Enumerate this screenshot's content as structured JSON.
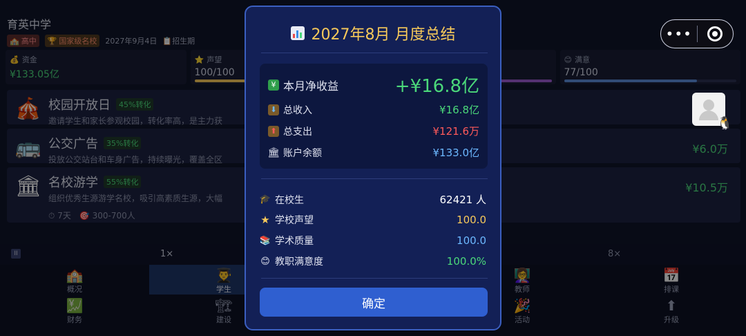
{
  "background": {
    "school_name": "育英中学",
    "tags": [
      "高中",
      "国家级名校",
      "2027年9月4日",
      "招生期"
    ],
    "stats": [
      {
        "label": "资金",
        "value": "¥133.05亿",
        "icon": "money-bag-icon"
      },
      {
        "label": "声望",
        "value": "100/100",
        "icon": "star-icon",
        "progress": 1.0
      },
      {
        "label": "",
        "value": "",
        "icon": ""
      },
      {
        "label": "满意",
        "value": "77/100",
        "icon": "smile-icon",
        "progress": 0.77
      }
    ],
    "activities": [
      {
        "title": "校园开放日",
        "conversion": "45%转化",
        "desc": "邀请学生和家长参观校园，转化率高，是主力获",
        "price": "",
        "icon": "circus-tent-icon"
      },
      {
        "title": "公交广告",
        "conversion": "35%转化",
        "desc": "投放公交站台和车身广告，持续曝光，覆盖全区",
        "price": "¥6.0万",
        "icon": "bus-icon"
      },
      {
        "title": "名校游学",
        "conversion": "55%转化",
        "desc": "组织优秀生源游学名校，吸引高素质生源，大幅",
        "price": "¥10.5万",
        "icon": "classical-building-icon"
      }
    ],
    "activity_meta": [
      "7天",
      "300-700人"
    ],
    "speed": {
      "pause": "II",
      "left": "1×",
      "right": "8×"
    },
    "nav": [
      {
        "label": "概况",
        "icon": "school-icon"
      },
      {
        "label": "学生",
        "icon": "students-icon"
      },
      {
        "label": "教师",
        "icon": "teachers-icon"
      },
      {
        "label": "排课",
        "icon": "calendar-icon"
      },
      {
        "label": "财务",
        "icon": "money-icon"
      },
      {
        "label": "建设",
        "icon": "construction-icon"
      },
      {
        "label": "活动",
        "icon": "party-icon"
      },
      {
        "label": "升级",
        "icon": "upgrade-icon"
      }
    ],
    "capsule": {
      "more": "•••",
      "close_icon": "target-icon"
    }
  },
  "modal": {
    "title": "2027年8月  月度总结",
    "title_icon": "bar-chart-icon",
    "net_income": {
      "label": "本月净收益",
      "value": "+¥16.8亿",
      "icon": "chart-increase-icon"
    },
    "finance": [
      {
        "label": "总收入",
        "value": "¥16.8亿",
        "icon": "inbox-icon",
        "color": "#4bd87a"
      },
      {
        "label": "总支出",
        "value": "¥121.6万",
        "icon": "outbox-icon",
        "color": "#ff5a5a"
      },
      {
        "label": "账户余额",
        "value": "¥133.0亿",
        "icon": "bank-icon",
        "color": "#6cb8ff"
      }
    ],
    "stats": [
      {
        "label": "在校生",
        "value": "62421 人",
        "icon": "graduation-cap-icon",
        "color": "#ffffff"
      },
      {
        "label": "学校声望",
        "value": "100.0",
        "icon": "star-icon",
        "color": "#f7c95a"
      },
      {
        "label": "学术质量",
        "value": "100.0",
        "icon": "books-icon",
        "color": "#6cb8ff"
      },
      {
        "label": "教职满意度",
        "value": "100.0%",
        "icon": "smile-icon",
        "color": "#4bd87a"
      }
    ],
    "confirm_label": "确定"
  }
}
